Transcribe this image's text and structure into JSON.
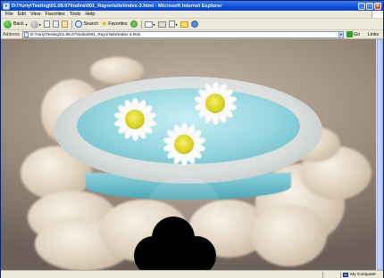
{
  "window": {
    "title": "D:\\Yuriy\\Testing\\01.09.07\\Indira\\001_Rayon\\site\\index-3.html - Microsoft Internet Explorer"
  },
  "menu": {
    "items": [
      "File",
      "Edit",
      "View",
      "Favorites",
      "Tools",
      "Help"
    ]
  },
  "toolbar": {
    "back_label": "Back",
    "search_label": "Search",
    "favorites_label": "Favorites"
  },
  "address": {
    "label": "Address",
    "value": "D:\\Yuriy\\Testing\\01.09.07\\Indira\\001_Rayon\\site\\index-3.html",
    "go_label": "Go",
    "links_label": "Links"
  },
  "status": {
    "zone": "My Computer"
  },
  "colors": {
    "titlebar": "#0b4fd6",
    "chrome": "#ece9d8",
    "water": "#95d6e0"
  },
  "icons": {
    "back": "back-arrow-icon",
    "forward": "forward-arrow-icon",
    "stop": "stop-icon",
    "refresh": "refresh-icon",
    "home": "home-icon",
    "search": "search-icon",
    "favorites": "star-icon",
    "media": "media-icon",
    "mail": "mail-icon",
    "print": "printer-icon",
    "edit": "edit-icon",
    "folder": "folder-icon",
    "messenger": "messenger-icon"
  }
}
